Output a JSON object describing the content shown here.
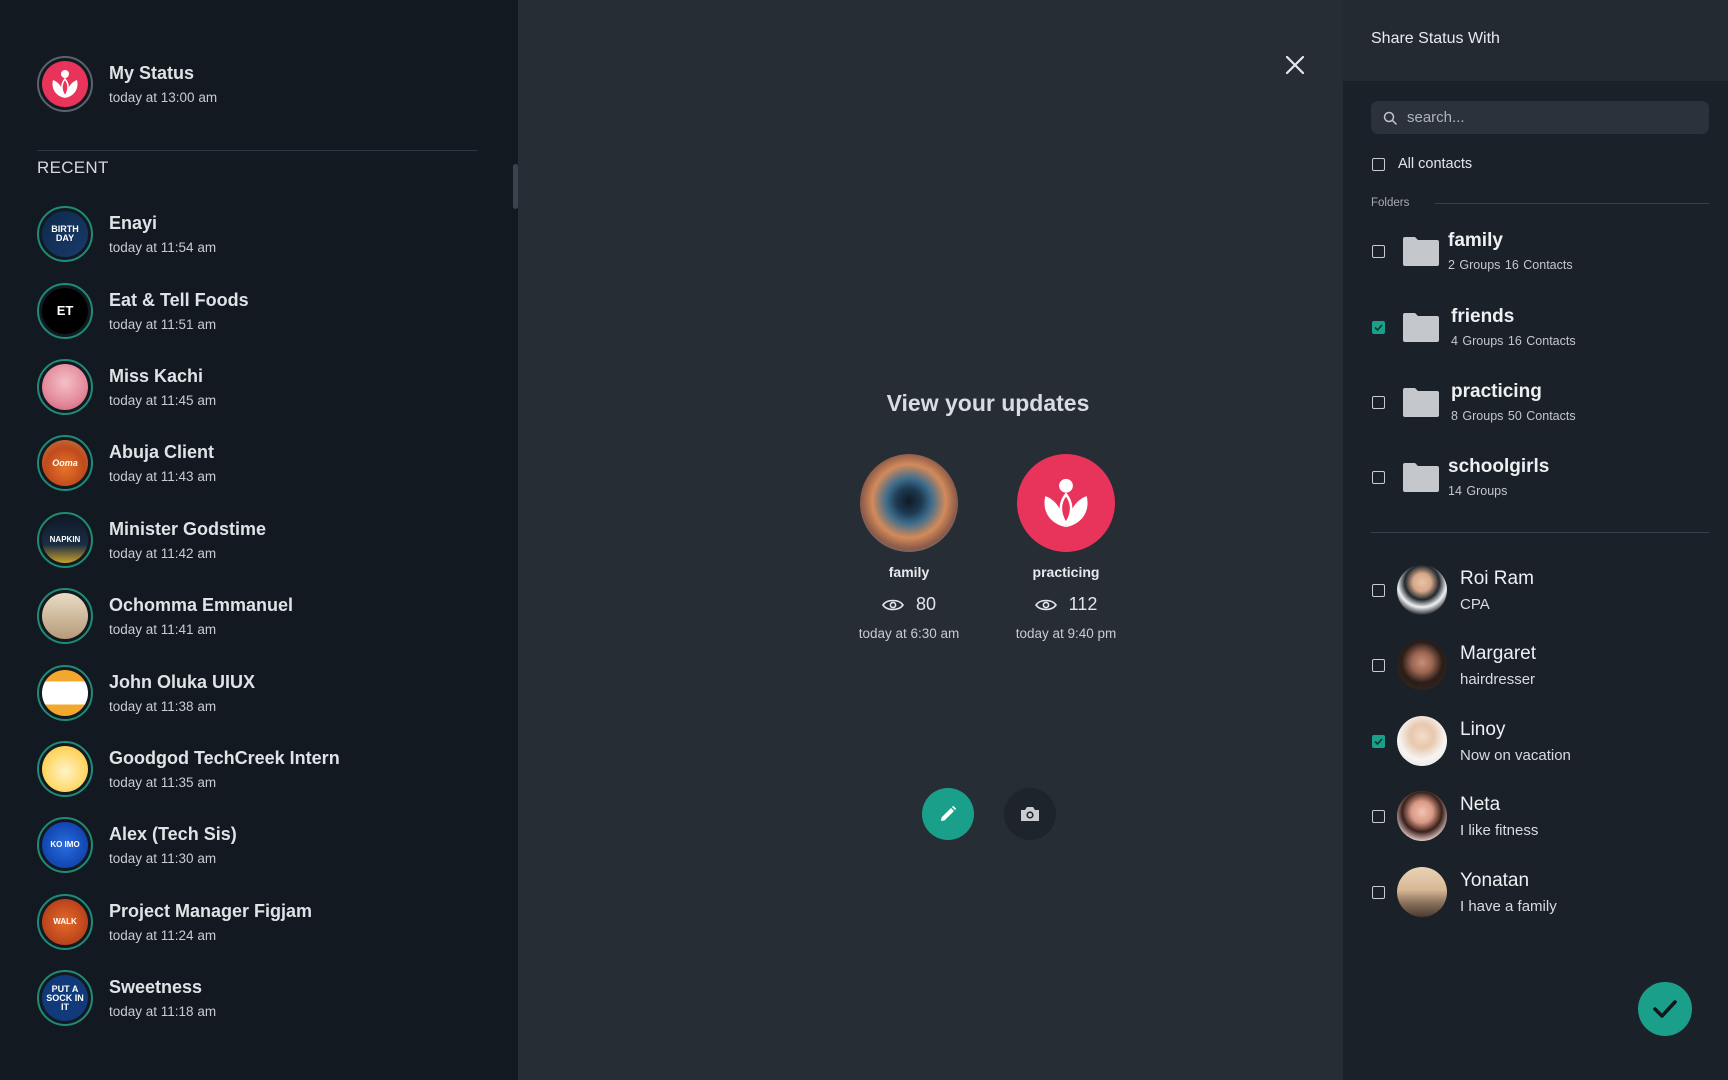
{
  "my_status": {
    "name": "My Status",
    "time": "today at 13:00 am"
  },
  "recent_label": "RECENT",
  "recent": [
    {
      "name": "Enayi",
      "time": "today at 11:54 am",
      "avatar_text": "BIRTH DAY"
    },
    {
      "name": "Eat & Tell Foods",
      "time": "today at 11:51 am",
      "avatar_text": "ET"
    },
    {
      "name": "Miss Kachi",
      "time": "today at 11:45 am",
      "avatar_text": ""
    },
    {
      "name": "Abuja Client",
      "time": "today at 11:43 am",
      "avatar_text": "Ooma"
    },
    {
      "name": "Minister Godstime",
      "time": "today at 11:42 am",
      "avatar_text": "NAPKIN"
    },
    {
      "name": "Ochomma Emmanuel",
      "time": "today at 11:41 am",
      "avatar_text": ""
    },
    {
      "name": "John Oluka UIUX",
      "time": "today at 11:38 am",
      "avatar_text": ""
    },
    {
      "name": "Goodgod TechCreek Intern",
      "time": "today at 11:35 am",
      "avatar_text": ""
    },
    {
      "name": "Alex (Tech Sis)",
      "time": "today at 11:30 am",
      "avatar_text": "KO IMO"
    },
    {
      "name": "Project Manager Figjam",
      "time": "today at 11:24 am",
      "avatar_text": "WALK"
    },
    {
      "name": "Sweetness",
      "time": "today at 11:18 am",
      "avatar_text": "PUT A SOCK IN IT"
    }
  ],
  "center": {
    "title": "View your updates",
    "updates": [
      {
        "label": "family",
        "views": "80",
        "time": "today at 6:30 am"
      },
      {
        "label": "practicing",
        "views": "112",
        "time": "today at 9:40 pm"
      }
    ]
  },
  "share": {
    "title": "Share Status With",
    "search_placeholder": "search...",
    "all_contacts": "All contacts",
    "folders_label": "Folders",
    "folders": [
      {
        "name": "family",
        "groups": "2 Groups",
        "contacts": "16 Contacts",
        "checked": false
      },
      {
        "name": "friends",
        "groups": "4 Groups",
        "contacts": "16 Contacts",
        "checked": true
      },
      {
        "name": "practicing",
        "groups": "8 Groups",
        "contacts": "50 Contacts",
        "checked": false
      },
      {
        "name": "schoolgirls",
        "groups": "14 Groups",
        "contacts": "",
        "checked": false
      }
    ],
    "contacts": [
      {
        "name": "Roi Ram",
        "sub": "CPA",
        "checked": false
      },
      {
        "name": "Margaret",
        "sub": "hairdresser",
        "checked": false
      },
      {
        "name": "Linoy",
        "sub": "Now on vacation",
        "checked": true
      },
      {
        "name": "Neta",
        "sub": "I like fitness",
        "checked": false
      },
      {
        "name": "Yonatan",
        "sub": "I have a family",
        "checked": false
      }
    ]
  },
  "colors": {
    "accent": "#1aa08a",
    "brand": "#e8345a",
    "left_bg": "#131920",
    "center_bg": "#272d35",
    "right_bg": "#1b2129"
  }
}
